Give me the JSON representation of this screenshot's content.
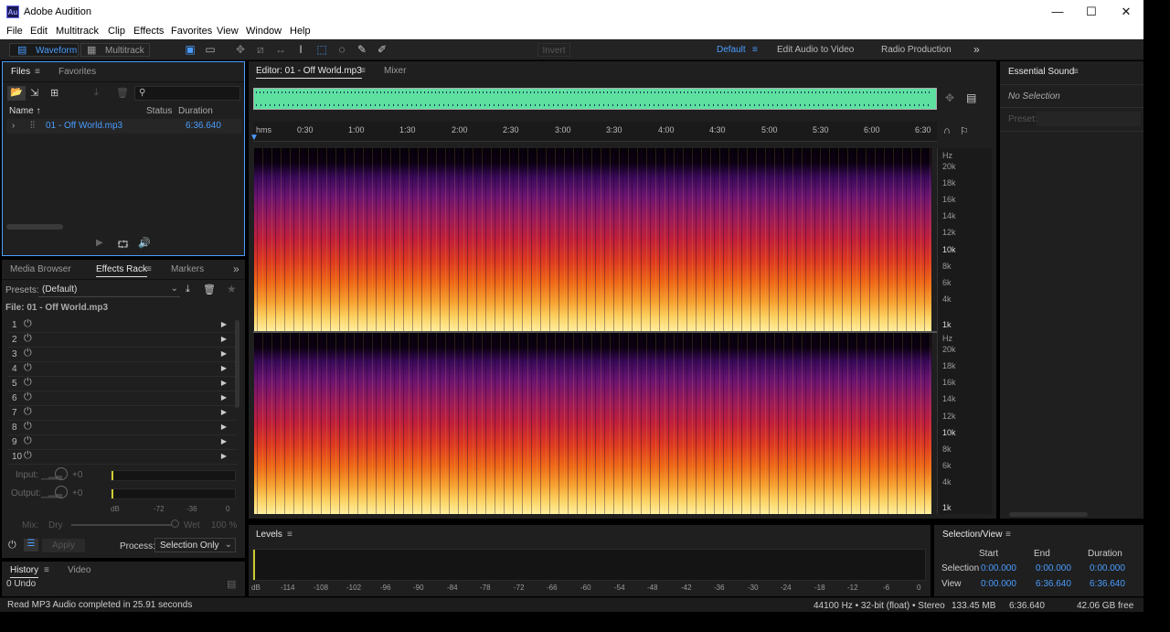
{
  "app": {
    "title": "Adobe Audition",
    "icon_text": "Au",
    "minimize": "—",
    "maximize": "☐",
    "close": "✕"
  },
  "menu": [
    "File",
    "Edit",
    "Multitrack",
    "Clip",
    "Effects",
    "Favorites",
    "View",
    "Window",
    "Help"
  ],
  "toolbar": {
    "waveform_label": "Waveform",
    "multitrack_label": "Multitrack",
    "invert_label": "Invert",
    "workspaces": [
      "Default",
      "Edit Audio to Video",
      "Radio Production"
    ],
    "more": "»"
  },
  "files_panel": {
    "tabs": [
      "Files",
      "Favorites"
    ],
    "search_placeholder": "",
    "columns": [
      "Name ↑",
      "Status",
      "Duration"
    ],
    "items": [
      {
        "name": "01 - Off World.mp3",
        "status": "",
        "duration": "6:36.640"
      }
    ]
  },
  "effects_panel": {
    "tabs": [
      "Media Browser",
      "Effects Rack",
      "Markers"
    ],
    "presets_label": "Presets:",
    "presets_value": "(Default)",
    "file_label": "File: 01 - Off World.mp3",
    "slots": [
      "1",
      "2",
      "3",
      "4",
      "5",
      "6",
      "7",
      "8",
      "9",
      "10"
    ],
    "input_label": "Input:",
    "input_value": "+0",
    "output_label": "Output:",
    "output_value": "+0",
    "scale": [
      "dB",
      "-72",
      "-36",
      "0"
    ],
    "mix_label": "Mix:",
    "mix_dry": "Dry",
    "mix_wet": "Wet",
    "mix_value": "100 %",
    "apply_label": "Apply",
    "process_label": "Process:",
    "process_value": "Selection Only"
  },
  "history_panel": {
    "tabs": [
      "History",
      "Video"
    ],
    "entries": [
      "0 Undo"
    ]
  },
  "status_left": "Read MP3 Audio completed in 25.91 seconds",
  "editor": {
    "tab": "Editor: 01 - Off World.mp3",
    "mixer_tab": "Mixer",
    "ruler_unit": "hms",
    "ruler_labels": [
      "0:30",
      "1:00",
      "1:30",
      "2:00",
      "2:30",
      "3:00",
      "3:30",
      "4:00",
      "4:30",
      "5:00",
      "5:30",
      "6:00",
      "6:30"
    ],
    "hz_unit": "Hz",
    "hz_labels": [
      "20k",
      "18k",
      "16k",
      "14k",
      "12k",
      "10k",
      "8k",
      "6k",
      "4k",
      "1k"
    ]
  },
  "levels_panel": {
    "title": "Levels",
    "scale": [
      "dB",
      "-114",
      "-108",
      "-102",
      "-96",
      "-90",
      "-84",
      "-78",
      "-72",
      "-66",
      "-60",
      "-54",
      "-48",
      "-42",
      "-36",
      "-30",
      "-24",
      "-18",
      "-12",
      "-6",
      "0"
    ]
  },
  "essential_sound": {
    "title": "Essential Sound",
    "no_selection": "No Selection",
    "preset_label": "Preset:"
  },
  "selection_view": {
    "title": "Selection/View",
    "headers": [
      "Start",
      "End",
      "Duration"
    ],
    "rows": [
      {
        "label": "Selection",
        "start": "0:00.000",
        "end": "0:00.000",
        "duration": "0:00.000"
      },
      {
        "label": "View",
        "start": "0:00.000",
        "end": "6:36.640",
        "duration": "6:36.640"
      }
    ]
  },
  "status_bar": {
    "format": "44100 Hz • 32-bit (float) • Stereo",
    "size": "133.45 MB",
    "duration": "6:36.640",
    "free": "42.06 GB free"
  },
  "colors": {
    "accent": "#4a9dff",
    "waveform": "#5de0a0"
  }
}
